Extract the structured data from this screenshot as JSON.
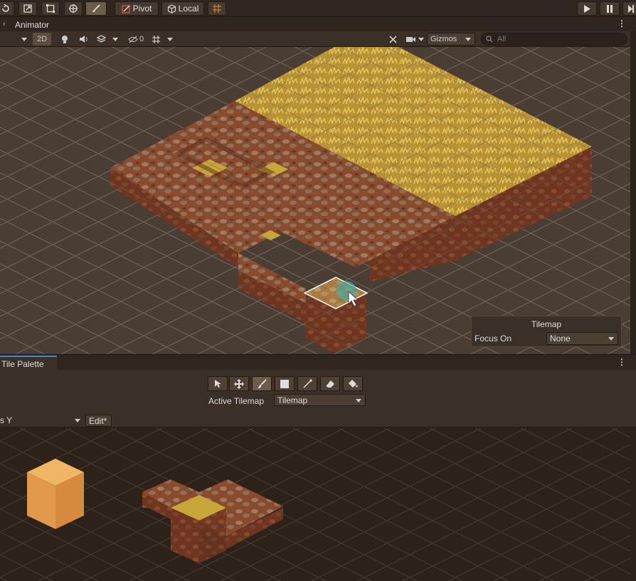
{
  "toolbar": {
    "pivot_label": "Pivot",
    "local_label": "Local",
    "tools": [
      "rotate-icon",
      "scale-icon",
      "rect-icon",
      "transform-icon",
      "brush-icon"
    ]
  },
  "scene": {
    "tab_title": "Animator",
    "mode_2d": "2D",
    "hidden_count": "0",
    "gizmos_label": "Gizmos",
    "search_placeholder": "All"
  },
  "overlay": {
    "title": "Tilemap",
    "focus_label": "Focus On",
    "focus_value": "None"
  },
  "palette": {
    "tab_title": "Tile Palette",
    "active_tilemap_label": "Active Tilemap",
    "active_tilemap_value": "Tilemap",
    "left_dropdown_value": "s Y",
    "edit_label": "Edit*"
  },
  "colors": {
    "scene_bg": "#4a3d33",
    "palette_bg": "#2c221a",
    "accent": "#3f8adb",
    "grass": "#c9a63a",
    "dirt": "#8a4a2c"
  }
}
